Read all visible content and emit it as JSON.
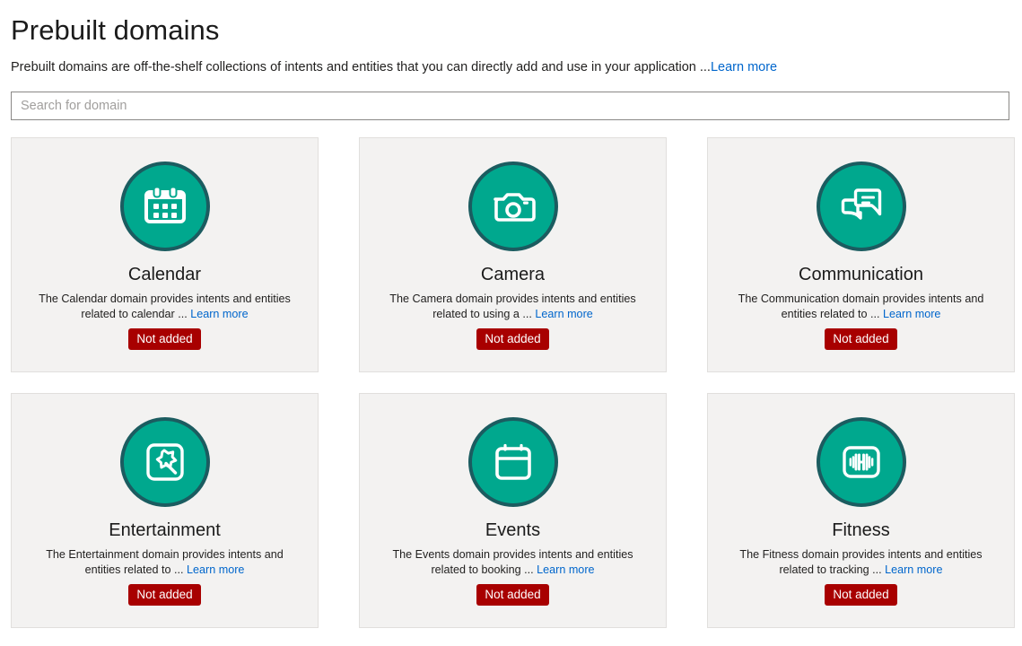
{
  "header": {
    "title": "Prebuilt domains",
    "subtitle_text": "Prebuilt domains are off-the-shelf collections of intents and entities that you can directly add and use in your application ...",
    "subtitle_link": "Learn more"
  },
  "search": {
    "placeholder": "Search for domain",
    "value": ""
  },
  "colors": {
    "icon_fill": "#00a88e",
    "icon_ring": "#1b5c60",
    "badge_bg": "#a80000",
    "card_bg": "#f3f2f1",
    "link": "#0066cc"
  },
  "cards": [
    {
      "title": "Calendar",
      "icon": "calendar-grid-icon",
      "description": "The Calendar domain provides intents and entities related to calendar ...",
      "link_label": "Learn more",
      "status": "Not added"
    },
    {
      "title": "Camera",
      "icon": "camera-icon",
      "description": "The Camera domain provides intents and entities related to using a ...",
      "link_label": "Learn more",
      "status": "Not added"
    },
    {
      "title": "Communication",
      "icon": "chat-bubbles-icon",
      "description": "The Communication domain provides intents and entities related to ...",
      "link_label": "Learn more",
      "status": "Not added"
    },
    {
      "title": "Entertainment",
      "icon": "magic-wand-icon",
      "description": "The Entertainment domain provides intents and entities related to ...",
      "link_label": "Learn more",
      "status": "Not added"
    },
    {
      "title": "Events",
      "icon": "calendar-outline-icon",
      "description": "The Events domain provides intents and entities related to booking ...",
      "link_label": "Learn more",
      "status": "Not added"
    },
    {
      "title": "Fitness",
      "icon": "dumbbell-icon",
      "description": "The Fitness domain provides intents and entities related to tracking ...",
      "link_label": "Learn more",
      "status": "Not added"
    }
  ]
}
